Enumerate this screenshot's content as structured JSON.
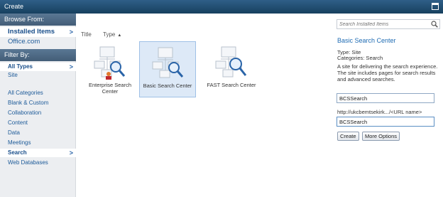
{
  "window": {
    "title": "Create"
  },
  "sidebar": {
    "browse_header": "Browse From:",
    "browse_items": [
      {
        "label": "Installed Items",
        "selected": true
      },
      {
        "label": "Office.com",
        "selected": false
      }
    ],
    "filter_header": "Filter By:",
    "type_items": [
      {
        "label": "All Types",
        "selected": true
      },
      {
        "label": "Site",
        "selected": false
      }
    ],
    "category_items": [
      {
        "label": "All Categories"
      },
      {
        "label": "Blank & Custom"
      },
      {
        "label": "Collaboration"
      },
      {
        "label": "Content"
      },
      {
        "label": "Data"
      },
      {
        "label": "Meetings"
      },
      {
        "label": "Search",
        "selected": true
      },
      {
        "label": "Web Databases"
      }
    ]
  },
  "main": {
    "sort_columns": [
      "Title",
      "Type"
    ],
    "sort_arrow": "▲",
    "templates": [
      {
        "label": "Enterprise Search Center",
        "icon": "enterprise-search-site-icon",
        "selected": false
      },
      {
        "label": "Basic Search Center",
        "icon": "basic-search-site-icon",
        "selected": true
      },
      {
        "label": "FAST Search Center",
        "icon": "fast-search-site-icon",
        "selected": false
      }
    ]
  },
  "details": {
    "search_placeholder": "Search Installed Items",
    "title": "Basic Search Center",
    "type_line": "Type: Site",
    "categories_line": "Categories: Search",
    "description": "A site for delivering the search experience. The site includes pages for search results and advanced searches.",
    "title_field_value": "BCSSearch",
    "url_prefix": "http://ukcbemtsekirk.../<URL name>",
    "url_field_value": "BCSSearch",
    "create_button": "Create",
    "more_options_button": "More Options"
  },
  "colors": {
    "titlebar": "#1f4a6d",
    "accent_link": "#1e5b99",
    "selected_tile_bg": "#dde9f7"
  }
}
